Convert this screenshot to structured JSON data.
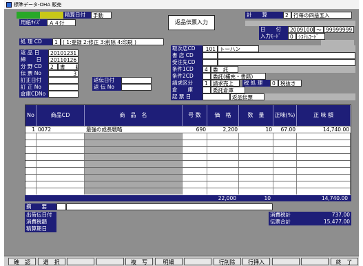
{
  "window": {
    "title": "標準データ-OHA 販売"
  },
  "top": {
    "tab_left_1": "",
    "tab_left_2": "",
    "seisan_label": "精算日付",
    "seisan_value": "手動",
    "kei_label": "計　　算",
    "kei_value": "2",
    "kei_text": "行毎の四捨五入",
    "yoshi_label": "用紙ｻｲｽﾞ",
    "yoshi_value": "Ａ４ﾀﾃ",
    "form_title": "返品伝票入力",
    "date_label": "日　　付",
    "date_from": "20091001",
    "date_sep": "〜",
    "date_to": "99999999",
    "input_mode_label": "入力ﾓｰﾄﾞ",
    "input_mode_value": "0",
    "input_mode_text": "ｼｽﾃﾑｺｰﾄﾞ"
  },
  "proc": {
    "label": "処 理 CD",
    "value": "1",
    "options": "( 1:登録 2:修正 3:削除 4:印刷 )"
  },
  "left_fields": [
    {
      "label": "返 品 日",
      "value": "20101231"
    },
    {
      "label": "締　　日",
      "value": "20110126"
    },
    {
      "label": "分 野 CD",
      "value": "2",
      "extra": "書　　籍"
    },
    {
      "label": "伝 票 No",
      "value": "3"
    },
    {
      "label": "訂正日付",
      "value": ""
    },
    {
      "label": "訂 正 No",
      "value": ""
    },
    {
      "label": "倉庫CDNo",
      "value": ""
    }
  ],
  "mid_fields": [
    {
      "label": "返伝日付",
      "value": ""
    },
    {
      "label": "返 伝 No",
      "value": ""
    }
  ],
  "right_fields": [
    {
      "label": "取次店CD",
      "value": "101",
      "text": "トーハン"
    },
    {
      "label": "書 店 CD",
      "value": "",
      "text": ""
    },
    {
      "label": "受注先CD",
      "value": "",
      "text": ""
    },
    {
      "label": "条件1CD",
      "value": "4",
      "text": "委　託"
    },
    {
      "label": "条件2CD",
      "value": "",
      "text": "委託(補充・書籍)"
    },
    {
      "label": "請求区分",
      "value": "1",
      "text": "請求売上"
    },
    {
      "label": "倉　　庫",
      "value": "",
      "text": "委託倉庫"
    },
    {
      "label": "起 票 日",
      "value": "",
      "text": "返品伝票"
    }
  ],
  "right_extra": [
    {
      "label": "税 処 理",
      "value": "0",
      "text": "税抜き"
    }
  ],
  "grid": {
    "headers": [
      "No",
      "商品CD",
      "商　品　名",
      "号 数",
      "価　格",
      "数　量",
      "正味(%)",
      "正 味 額"
    ],
    "rows": [
      {
        "no": "1",
        "code": "0072",
        "name": "最強の成長戦略",
        "issue": "690",
        "price": "2,200",
        "qty": "10",
        "rate": "67.00",
        "amount": "14,740.00"
      }
    ],
    "empty_rows": 9,
    "totals": {
      "price": "22,000",
      "qty": "10",
      "amount": "14,740.00"
    }
  },
  "bottom": {
    "memo_label": "摘　　要",
    "memo_value": "",
    "left_labels": [
      "出荷伝日付",
      "消費税額",
      "精算期日"
    ],
    "tax_label": "消費税計",
    "tax_value": "737.00",
    "total_label": "伝票合計",
    "total_value": "15,477.00"
  },
  "fkeys": [
    "確　認",
    "選　択",
    "",
    "",
    "複　写",
    "明細",
    "",
    "行削除",
    "行挿入",
    "",
    "",
    "終　了"
  ]
}
